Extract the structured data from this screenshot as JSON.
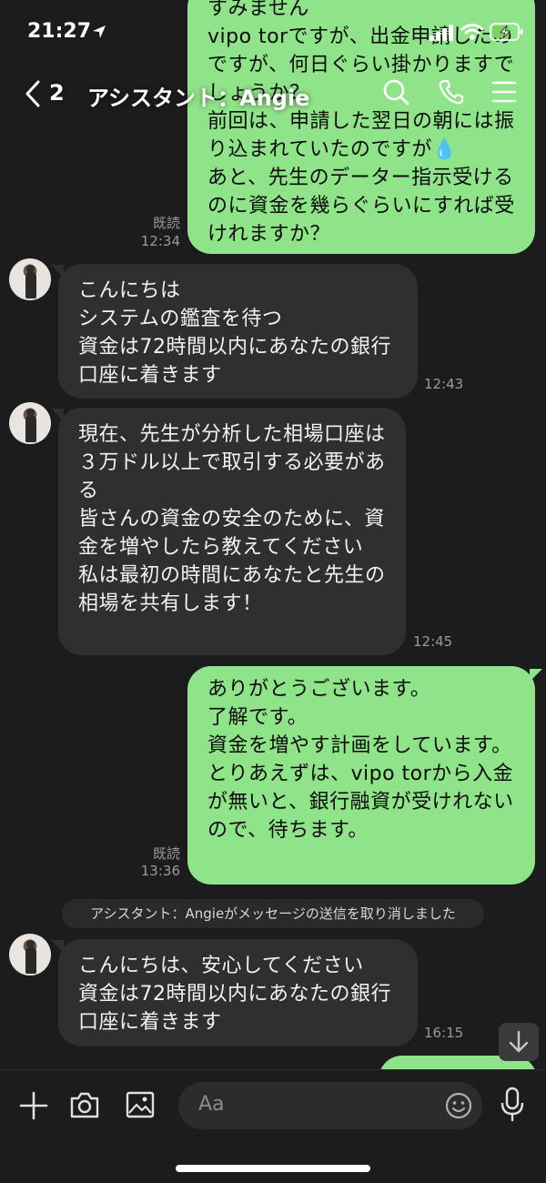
{
  "status_bar": {
    "time": "21:27"
  },
  "header": {
    "back_count": "2",
    "title": "アシスタント：Angie"
  },
  "messages": [
    {
      "id": "m1",
      "direction": "out",
      "text": "すみません\nvipo torですが、出金申請したのですが、何日ぐらい掛かりますでしょうか？\n前回は、申請した翌日の朝には振り込まれていたのですが💧\nあと、先生のデーター指示受けるのに資金を幾らぐらいにすれば受けれますか？",
      "read_label": "既読",
      "time": "12:34"
    },
    {
      "id": "m2",
      "direction": "in",
      "text": "こんにちは\nシステムの鑑査を待つ\n資金は72時間以内にあなたの銀行口座に着きます",
      "time": "12:43"
    },
    {
      "id": "m3",
      "direction": "in",
      "text": "現在、先生が分析した相場口座は３万ドル以上で取引する必要がある\n皆さんの資金の安全のために、資金を増やしたら教えてください\n私は最初の時間にあなたと先生の相場を共有します！",
      "time": "12:45"
    },
    {
      "id": "m4",
      "direction": "out",
      "text": "ありがとうございます。\n了解です。\n資金を増やす計画をしています。\nとりあえずは、vipo torから入金が無いと、銀行融資が受けれないので、待ちます。",
      "read_label": "既読",
      "time": "13:36"
    },
    {
      "id": "notice",
      "direction": "system",
      "text": "アシスタント：Angieがメッセージの送信を取り消しました"
    },
    {
      "id": "m5",
      "direction": "in",
      "text": "こんにちは、安心してください\n資金は72時間以内にあなたの銀行口座に着きます",
      "time": "16:15"
    }
  ],
  "input": {
    "placeholder": "Aa"
  },
  "colors": {
    "background": "#1c1c1e",
    "outgoing_bubble": "#8fe388",
    "incoming_bubble": "#2f2f31"
  }
}
